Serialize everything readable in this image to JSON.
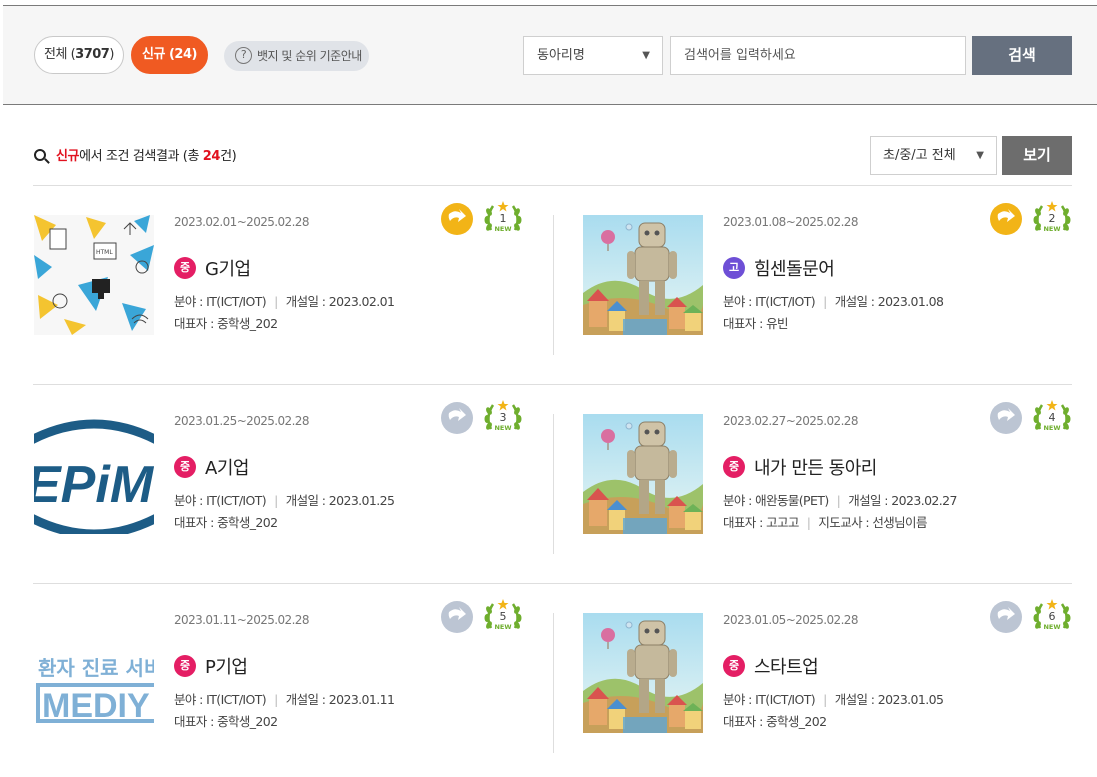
{
  "filters": {
    "all_prefix": "전체 (",
    "all_count": "3707",
    "all_suffix": ")",
    "new_label": "신규 (24)",
    "guide_label": "뱃지 및 순위 기준안내"
  },
  "search": {
    "category": "동아리명",
    "placeholder": "검색어를 입력하세요",
    "button": "검색"
  },
  "results": {
    "prefix_red": "신규",
    "middle": "에서 조건 검색결과 (총 ",
    "count": "24",
    "suffix": "건)",
    "level_filter": "초/중/고 전체",
    "view_button": "보기"
  },
  "labels": {
    "field": "분야 : ",
    "opened": "개설일 : ",
    "rep": "대표자 : ",
    "advisor": "지도교사 : "
  },
  "colors": {
    "accent": "#f05a22",
    "badge_active": "#f2b417",
    "badge_inactive": "#bcc5d3",
    "laurel": "#6fae2e",
    "level_middle": "#e41e64",
    "level_high": "#6e4fd6"
  },
  "cards": [
    {
      "period": "2023.02.01~2025.02.28",
      "level": "중",
      "name": "G기업",
      "field": "IT(ICT/IOT)",
      "opened": "2023.02.01",
      "rep": "중학생_202",
      "advisor": "",
      "rank": "1",
      "new": "NEW",
      "active": true,
      "thumb": "icons-thumb"
    },
    {
      "period": "2023.01.08~2025.02.28",
      "level": "고",
      "name": "힘센돌문어",
      "field": "IT(ICT/IOT)",
      "opened": "2023.01.08",
      "rep": "유빈",
      "advisor": "",
      "rank": "2",
      "new": "NEW",
      "active": true,
      "thumb": "robot-thumb"
    },
    {
      "period": "2023.01.25~2025.02.28",
      "level": "중",
      "name": "A기업",
      "field": "IT(ICT/IOT)",
      "opened": "2023.01.25",
      "rep": "중학생_202",
      "advisor": "",
      "rank": "3",
      "new": "NEW",
      "active": false,
      "thumb": "epim-logo-thumb",
      "thumb_text": "EPiM"
    },
    {
      "period": "2023.02.27~2025.02.28",
      "level": "중",
      "name": "내가 만든 동아리",
      "field": "애완동물(PET)",
      "opened": "2023.02.27",
      "rep": "고고고",
      "advisor": "선생님이름",
      "rank": "4",
      "new": "NEW",
      "active": false,
      "thumb": "robot-thumb"
    },
    {
      "period": "2023.01.11~2025.02.28",
      "level": "중",
      "name": "P기업",
      "field": "IT(ICT/IOT)",
      "opened": "2023.01.11",
      "rep": "중학생_202",
      "advisor": "",
      "rank": "5",
      "new": "NEW",
      "active": false,
      "thumb": "mediy-logo-thumb",
      "thumb_text_1": "환자 진료 서비",
      "thumb_text_2": "MEDIY"
    },
    {
      "period": "2023.01.05~2025.02.28",
      "level": "중",
      "name": "스타트업",
      "field": "IT(ICT/IOT)",
      "opened": "2023.01.05",
      "rep": "중학생_202",
      "advisor": "",
      "rank": "6",
      "new": "NEW",
      "active": false,
      "thumb": "robot-thumb"
    }
  ]
}
